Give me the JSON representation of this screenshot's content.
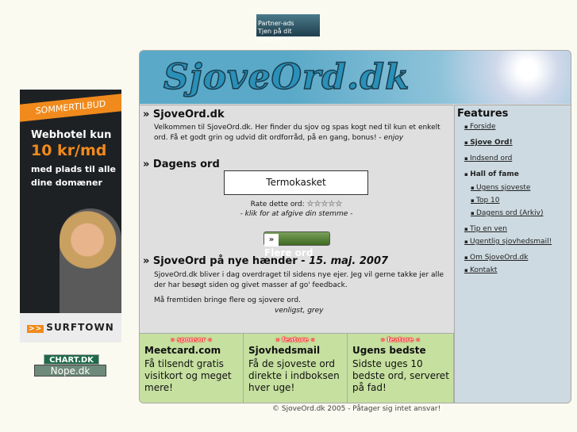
{
  "partner_ad": {
    "line1": "Partner-ads",
    "line2": "Tjen på dit website?"
  },
  "side_ad": {
    "ribbon": "SOMMERTILBUD",
    "line1": "Webhotel kun",
    "price": "10 kr/md",
    "line3": "med plads til alle",
    "line4": "dine domæner",
    "brand": "SURFTOWN",
    "brand_mark": ">>"
  },
  "badges": {
    "chart": "CHART.DK",
    "nope": "Nope.dk"
  },
  "header": {
    "logo": "SjoveOrd.dk"
  },
  "intro": {
    "title": "» SjoveOrd.dk",
    "text": "Velkommen til SjoveOrd.dk. Her finder du sjov og spas kogt ned til kun et enkelt ord. Få et godt grin og udvid dit ordforråd, på en gang, bonus! -",
    "enjoy": "enjoy"
  },
  "word_of_day": {
    "title": "» Dagens ord",
    "word": "Termokasket",
    "rate_label": "Rate dette ord:",
    "stars": "☆☆☆☆☆",
    "hint": "- klik for at afgive din stemme -",
    "more_icon": "»",
    "more_button": "Flere ord"
  },
  "news": {
    "title": "» SjoveOrd på nye hænder - ",
    "date": "15. maj. 2007",
    "p1": "SjoveOrd.dk bliver i dag overdraget til sidens nye ejer. Jeg vil gerne takke jer alle der har besøgt siden og givet masser af go' feedback.",
    "p2": "Må fremtiden bringe flere og sjovere ord.",
    "sign": "venligst, grey"
  },
  "features": {
    "title": "Features",
    "items": [
      "Forside",
      "Sjove Ord!",
      "Indsend ord",
      "Hall of fame",
      "Ugens sjoveste",
      "Top 10",
      "Dagens ord (Arkiv)",
      "Tip en ven",
      "Ugentlig sjovhedsmail!",
      "Om SjoveOrd.dk",
      "Kontakt"
    ]
  },
  "boxes": [
    {
      "tag": "» sponsor «",
      "title": "Meetcard.com",
      "text": "Få tilsendt gratis visitkort og meget mere!"
    },
    {
      "tag": "» feature «",
      "title": "Sjovhedsmail",
      "text": "Få de sjoveste ord direkte i indboksen hver uge!"
    },
    {
      "tag": "» feature «",
      "title": "Ugens bedste",
      "text": "Sidste uges 10 bedste ord, serveret på fad!"
    }
  ],
  "footer": "© SjoveOrd.dk 2005 - Påtager sig intet ansvar!"
}
